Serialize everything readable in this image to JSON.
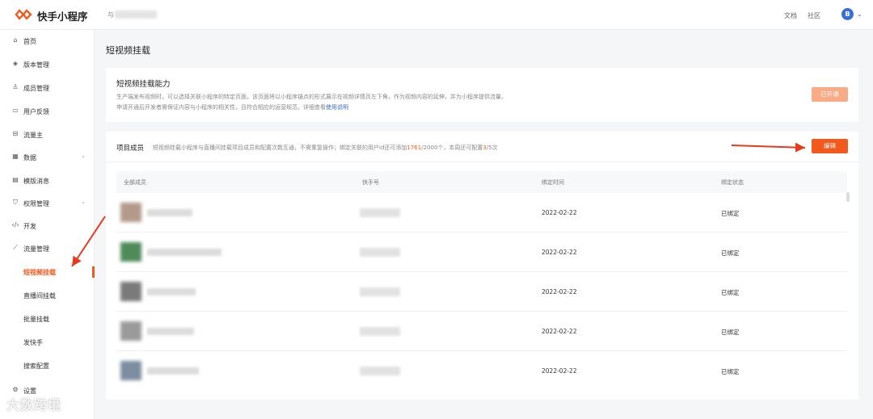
{
  "header": {
    "brand": "快手小程序",
    "account_prefix": "与",
    "links": [
      "文档",
      "社区"
    ],
    "avatar_letter": "B"
  },
  "sidebar": {
    "items": [
      {
        "label": "首页",
        "icon": "home-icon"
      },
      {
        "label": "版本管理",
        "icon": "layers-icon"
      },
      {
        "label": "成员管理",
        "icon": "users-icon"
      },
      {
        "label": "用户反馈",
        "icon": "message-icon"
      },
      {
        "label": "流量主",
        "icon": "wallet-icon"
      },
      {
        "label": "数据",
        "icon": "chart-icon",
        "expandable": true
      },
      {
        "label": "模版消息",
        "icon": "template-icon"
      },
      {
        "label": "权限管理",
        "icon": "shield-icon",
        "expandable": true
      },
      {
        "label": "开发",
        "icon": "code-icon"
      },
      {
        "label": "流量管理",
        "icon": "trend-icon"
      }
    ],
    "subitems": [
      {
        "label": "短视频挂载",
        "active": true
      },
      {
        "label": "直播间挂载"
      },
      {
        "label": "批量挂载"
      },
      {
        "label": "发快手"
      },
      {
        "label": "搜索配置"
      }
    ],
    "last_item": {
      "label": "设置",
      "icon": "settings-icon"
    }
  },
  "page": {
    "title": "短视频挂载"
  },
  "capability": {
    "title": "短视频挂载能力",
    "desc_line1": "生产端发布视频时，可以选择关联小程序的特定页面，该页面将以小程序锚点的形式展示在视频详情页左下角，作为视频内容的延伸，并为小程序提供流量。",
    "desc_line2": "申请开通后开发者需保证内容与小程序的相关性，且符合相应的运营规范。详细查看",
    "desc_link": "使用说明",
    "button": "已开通"
  },
  "members": {
    "title": "项目成员",
    "desc_a": "短视频挂载小程序与直播间挂载项目成员和配置次数互通，不需重复操作；绑定关联的用户id还可添加",
    "desc_num1": "1761",
    "desc_b": "/2000个，本周还可配置",
    "desc_num2": "3",
    "desc_c": "/5次",
    "edit_button": "编辑",
    "columns": [
      "全部成员",
      "快手号",
      "绑定时间",
      "绑定状态"
    ],
    "rows": [
      {
        "date": "2022-02-22",
        "status": "已绑定",
        "avatar_color": "#b49a8a"
      },
      {
        "date": "2022-02-22",
        "status": "已绑定",
        "avatar_color": "#4e8a5a"
      },
      {
        "date": "2022-02-22",
        "status": "已绑定",
        "avatar_color": "#7a7a7a"
      },
      {
        "date": "2022-02-22",
        "status": "已绑定",
        "avatar_color": "#9a9a9a"
      },
      {
        "date": "2022-02-22",
        "status": "已绑定",
        "avatar_color": "#7d8da0"
      }
    ]
  },
  "watermark": "大数跨境",
  "colors": {
    "accent": "#f25a1d",
    "accent_light": "#f9ab86",
    "link": "#3a6fd4"
  }
}
